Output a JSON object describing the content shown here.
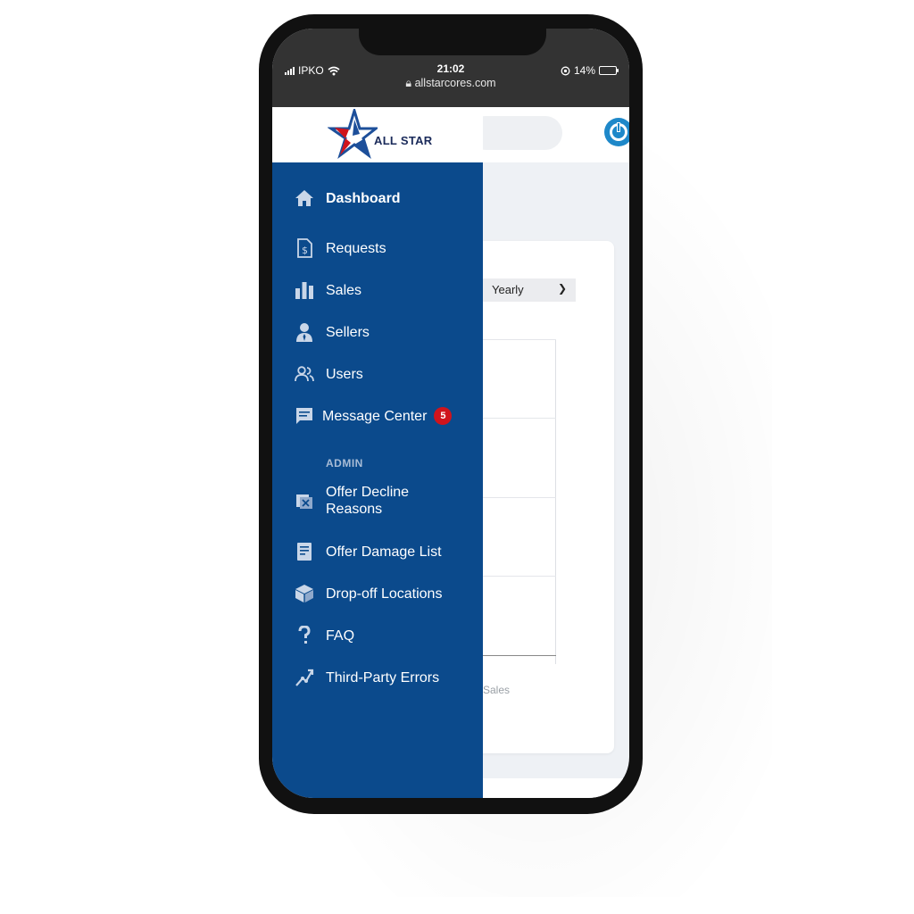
{
  "status_bar": {
    "carrier": "IPKO",
    "time": "21:02",
    "url": "allstarcores.com",
    "battery": "14%",
    "battery_level": 0.14
  },
  "brand": {
    "name": "ALL STAR",
    "colors": {
      "sidebar": "#0b4a8c",
      "star_red": "#d0141c",
      "star_blue": "#1d4f9a",
      "badge": "#d0141c",
      "power": "#1e88c9"
    }
  },
  "sidebar": {
    "items": [
      {
        "label": "Dashboard",
        "icon": "home-icon"
      },
      {
        "label": "Requests",
        "icon": "invoice-icon"
      },
      {
        "label": "Sales",
        "icon": "bar-chart-icon"
      },
      {
        "label": "Sellers",
        "icon": "person-icon"
      },
      {
        "label": "Users",
        "icon": "users-icon"
      },
      {
        "label": "Message Center",
        "icon": "message-icon",
        "badge": "5"
      }
    ],
    "admin_title": "ADMIN",
    "admin_items": [
      {
        "label": "Offer Decline Reasons",
        "line1": "Offer Decline",
        "line2": "Reasons",
        "icon": "decline-icon"
      },
      {
        "label": "Offer Damage List",
        "icon": "damage-list-icon"
      },
      {
        "label": "Drop-off Locations",
        "icon": "box-icon"
      },
      {
        "label": "FAQ",
        "icon": "question-icon"
      },
      {
        "label": "Third-Party Errors",
        "icon": "bug-icon"
      }
    ]
  },
  "main": {
    "period_select": "Yearly",
    "chart_legend": "Sales"
  }
}
